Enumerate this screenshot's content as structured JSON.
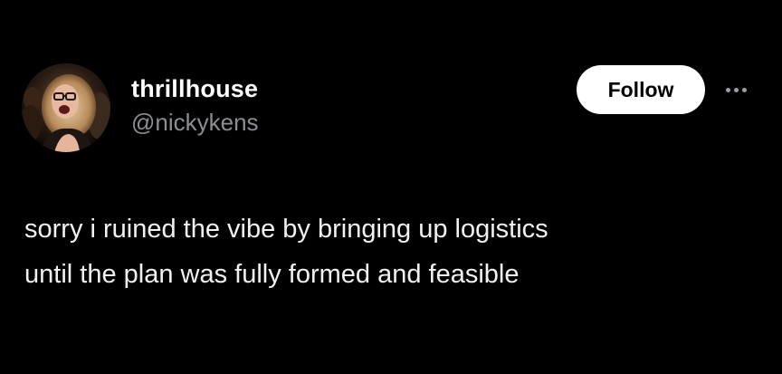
{
  "author": {
    "display_name": "thrillhouse",
    "handle": "@nickykens",
    "avatar_icon": "profile-photo"
  },
  "actions": {
    "follow_label": "Follow",
    "more_icon": "ellipsis-icon"
  },
  "tweet": {
    "lines": [
      "sorry i ruined the vibe by bringing up logistics",
      "until the plan was fully formed and feasible"
    ]
  },
  "colors": {
    "background": "#000000",
    "text": "#ffffff",
    "secondary_text": "#8b8f94",
    "button_bg": "#ffffff",
    "button_text": "#000000"
  }
}
